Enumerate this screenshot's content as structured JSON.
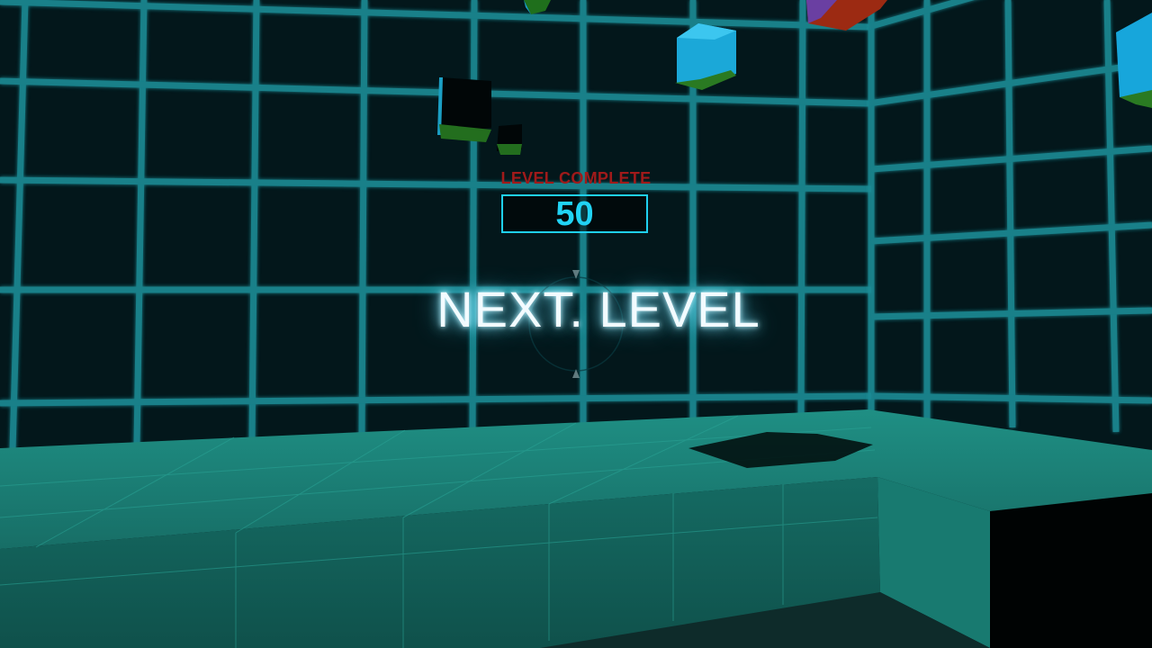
{
  "hud": {
    "status_label": "LEVEL COMPLETE",
    "score": "50",
    "next_level_label": "NEXT. LEVEL"
  },
  "colors": {
    "grid_line": "#1a8c96",
    "wall": "#03161a",
    "floor": "#1d8a80",
    "status_text": "#a01a1a",
    "score_accent": "#21d3f5"
  },
  "scene": {
    "cubes": [
      {
        "name": "cube-green-top",
        "color": "green"
      },
      {
        "name": "cube-red-purple",
        "color": "red"
      },
      {
        "name": "cube-blue-center",
        "color": "blue"
      },
      {
        "name": "cube-blue-right",
        "color": "blue"
      },
      {
        "name": "cube-black-large",
        "color": "black"
      },
      {
        "name": "cube-black-small",
        "color": "black"
      }
    ]
  }
}
